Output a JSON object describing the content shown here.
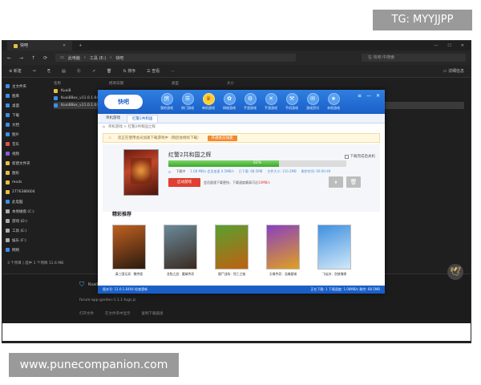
{
  "watermarks": {
    "top": "TG: MYYJJPP",
    "bottom": "www.punecompanion.com"
  },
  "explorer": {
    "tab_title": "快吧",
    "address": [
      "此电脑",
      "工具 (E:)",
      "快吧"
    ],
    "search_placeholder": "在 快吧 中搜索",
    "toolbar": {
      "new": "新建",
      "sort": "排序",
      "view": "查看",
      "details": "详细信息"
    },
    "columns": [
      "名称",
      "修改日期",
      "类型",
      "大小"
    ],
    "files": [
      "Kuai8",
      "Kuai8Box_v11.0.1.6404...",
      "Kuai8Box_v11.0.1.6404..."
    ],
    "sidebar": [
      {
        "label": "主文件夹",
        "color": "#3d8ee8"
      },
      {
        "label": "图库",
        "color": "#3d8ee8"
      },
      {
        "label": "桌面",
        "color": "#3d8ee8"
      },
      {
        "label": "下载",
        "color": "#3d8ee8"
      },
      {
        "label": "文档",
        "color": "#3d8ee8"
      },
      {
        "label": "图片",
        "color": "#3d8ee8"
      },
      {
        "label": "音乐",
        "color": "#e0504a"
      },
      {
        "label": "视频",
        "color": "#8a5ad8"
      },
      {
        "label": "新建文件夹",
        "color": "#e8c040"
      },
      {
        "label": "图形",
        "color": "#e8c040"
      },
      {
        "label": "mods",
        "color": "#e8c040"
      },
      {
        "label": "2776386604",
        "color": "#e8c040"
      },
      {
        "label": "此电脑",
        "color": "#3d8ee8"
      },
      {
        "label": "本地磁盘 (C:)",
        "color": "#aaaaaa"
      },
      {
        "label": "游戏 (D:)",
        "color": "#aaaaaa"
      },
      {
        "label": "工具 (E:)",
        "color": "#aaaaaa"
      },
      {
        "label": "娱乐 (F:)",
        "color": "#aaaaaa"
      },
      {
        "label": "网络",
        "color": "#3d8ee8"
      }
    ],
    "status": "3 个项目  |  选中 1 个项目 11.6 MB",
    "downloads": {
      "item1": "Kuai8Box_v11.0.1.6404",
      "item2": "forum-app-garden-1.1.1-fugs.js",
      "item3_actions": [
        "打开文件",
        "在文件夹中显示",
        "复制下载链接"
      ]
    }
  },
  "app": {
    "logo_text": "快吧",
    "nav": [
      {
        "icon": "房",
        "label": "我的游戏"
      },
      {
        "icon": "☰",
        "label": "热门游戏"
      },
      {
        "icon": "♛",
        "label": "单机游戏"
      },
      {
        "icon": "✿",
        "label": "网络游戏"
      },
      {
        "icon": "⚙",
        "label": "手游游戏"
      },
      {
        "icon": "✕",
        "label": "手游游戏"
      },
      {
        "icon": "⚒",
        "label": "手机游戏"
      },
      {
        "icon": "✉",
        "label": "游戏资讯"
      },
      {
        "icon": "★",
        "label": "本地游戏"
      }
    ],
    "tabs": [
      "单机游戏",
      "红警2共和国"
    ],
    "breadcrumb": "单机游戏 > 红警2共和国之辉",
    "notice": {
      "text": "您正在使用会员加速下载游戏中（稍后会继续下载）",
      "button": "开通会员加速"
    },
    "game": {
      "title": "红警2共和国之辉",
      "checkbox_label": "下载完成后关机",
      "progress": 0.62,
      "progress_text": "62%",
      "stats_label": "下载中",
      "speed": "1.08 MB/s 会员加速 0.5MB/s",
      "downloaded": "已下载: 68.5MB",
      "total": "文件大小: 110.2MB",
      "remain": "剩余时间: 00:00:49",
      "start_button": "启动游戏",
      "vip_prefix": "会员超速下载更快，下载速度最高可达",
      "vip_highlight": "10MB/s",
      "pause_icon": "⏸",
      "delete_icon": "🗑"
    },
    "recommend_title": "精彩推荐",
    "recommend": [
      {
        "name": "真三国无双：魏传版",
        "c1": "#c06020",
        "c2": "#2a1a10"
      },
      {
        "name": "龙牧之战：魔域传奇",
        "c1": "#6a8a9a",
        "c2": "#3a2a20"
      },
      {
        "name": "僵尸战场：死亡之城",
        "c1": "#5aa030",
        "c2": "#c06010"
      },
      {
        "name": "天尊传奇：浩瀚星域",
        "c1": "#8a40c0",
        "c2": "#e0a020"
      },
      {
        "name": "飞仙决：剑侠情缘",
        "c1": "#4090e0",
        "c2": "#d0e8f8"
      }
    ],
    "status_left": "版本号: 11.0.1.6404  检查更新",
    "status_right": "正在下载: 1  下载速度: 1.08MB/s  剩余: 68.5MB"
  }
}
